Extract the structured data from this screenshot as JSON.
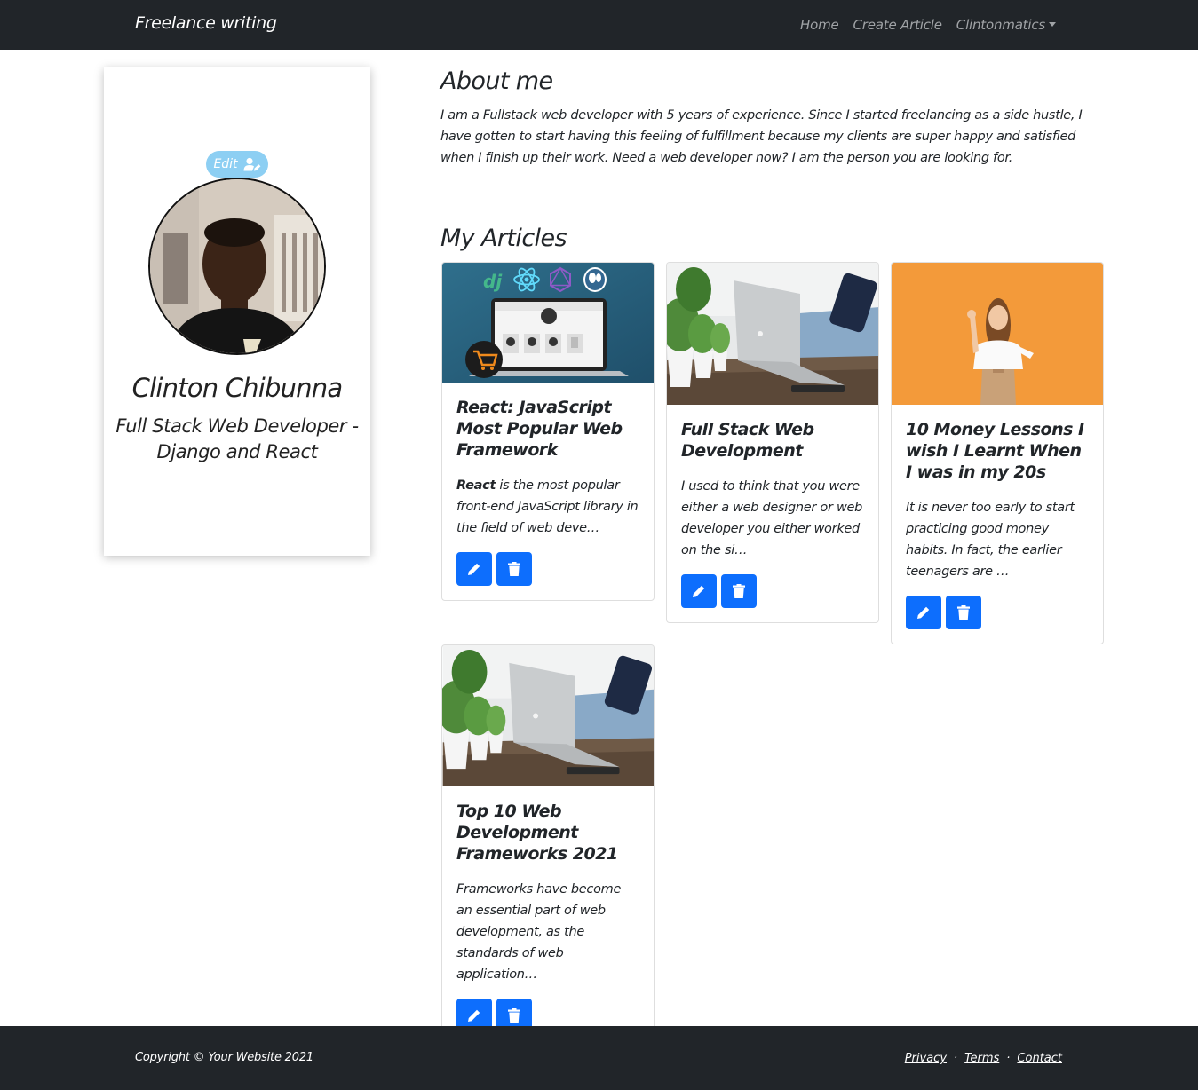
{
  "navbar": {
    "brand": "Freelance writing",
    "links": [
      "Home",
      "Create Article"
    ],
    "user_menu": "Clintonmatics"
  },
  "profile": {
    "edit_label": "Edit",
    "name": "Clinton Chibunna",
    "role": "Full Stack Web Developer - Django and React"
  },
  "about": {
    "title": "About me",
    "text": "I am a Fullstack web developer with 5 years of experience. Since I started freelancing as a side hustle, I have gotten to start having this feeling of fulfillment because my clients are super happy and satisfied when I finish up their work. Need a web developer now? I am the person you are looking for."
  },
  "articles": {
    "title": "My Articles",
    "items": [
      {
        "title": "React: JavaScript Most Popular Web Framework",
        "excerpt_bold": "React",
        "excerpt": " is the most popular front-end JavaScript library in the field of web deve…",
        "image": "dj",
        "edit_icon": "pencil-icon",
        "delete_icon": "trash-icon"
      },
      {
        "title": "Full Stack Web Development",
        "excerpt_bold": "",
        "excerpt": "I used to think that you were either a web designer or web developer you either worked on the si…",
        "image": "laptop-on-desk",
        "edit_icon": "pencil-icon",
        "delete_icon": "trash-icon"
      },
      {
        "title": "10 Money Lessons I wish I Learnt When I was in my 20s",
        "excerpt_bold": "",
        "excerpt": "It is never too early to start practicing good money habits. In fact, the earlier teenagers are …",
        "image": "woman-orange-background",
        "edit_icon": "pencil-icon",
        "delete_icon": "trash-icon"
      },
      {
        "title": "Top 10 Web Development Frameworks 2021",
        "excerpt_bold": "",
        "excerpt": "Frameworks have become an essential part of web development, as the standards of web application…",
        "image": "laptop-on-desk",
        "edit_icon": "pencil-icon",
        "delete_icon": "trash-icon"
      }
    ]
  },
  "footer": {
    "copyright": "Copyright © Your Website 2021",
    "links": [
      "Privacy",
      "Terms",
      "Contact"
    ],
    "separator": "·"
  },
  "colors": {
    "navbar": "#212529",
    "primary_button": "#0d6efd",
    "edit_badge": "#8dcff3",
    "orange_bg": "#f39a3a"
  }
}
